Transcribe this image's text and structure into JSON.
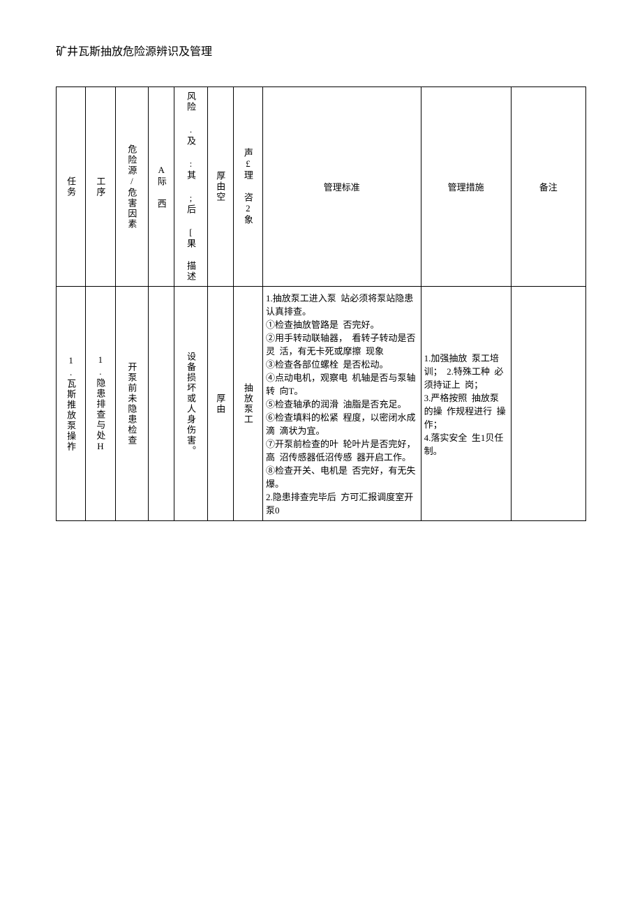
{
  "title": "矿井瓦斯抽放危险源辨识及管理",
  "head": {
    "c0": "任务",
    "c1": "工序",
    "c2": "危险源/危害因素",
    "c3": "A际 西",
    "c4": "风险 .及 :其 ;后 [果 描述",
    "c5": "厚由空",
    "c6": "声£理 咨2象",
    "c7": "管理标准",
    "c8": "管理措施",
    "c9": "备注"
  },
  "row": {
    "c0": "1.瓦斯推放泵操祚",
    "c1": "1.隐患排查与处H",
    "c2": "开泵前未隐患检查",
    "c3": "",
    "c4": "设备损坏或人身伤害。",
    "c5": "厚由",
    "c6": "抽放泵工",
    "c7": "1.抽放泵工进入泵  站必须将泵站隐患  认真排查。\n①检查抽放管路是  否完好。\n②用手转动联轴器，  看转子转动是否灵  活，有无卡死或摩擦  现象\n③检查各部位螺栓  是否松动。\n④点动电机，观察电  机轴是否与泵轴转  向T。\n⑤检查轴承的润滑  油脂是否充足。\n⑥检查填料的松紧  程度，以密闭水成滴  滴状为宜。\n⑦开泵前检查的叶  轮叶片是否完好，高  沼传感器低沼传感  器开启工作。\n⑧检查开关、电机是  否完好，有无失爆。\n2.隐患排查完毕后  方可汇报调度室开  泵0",
    "c8": "1.加强抽放  泵工培训；  2.特殊工种  必须持证上  岗；\n3.严格按照  抽放泵的操  作规程进行  操作；\n4.落实安全  生1贝任  制。",
    "c9": ""
  }
}
